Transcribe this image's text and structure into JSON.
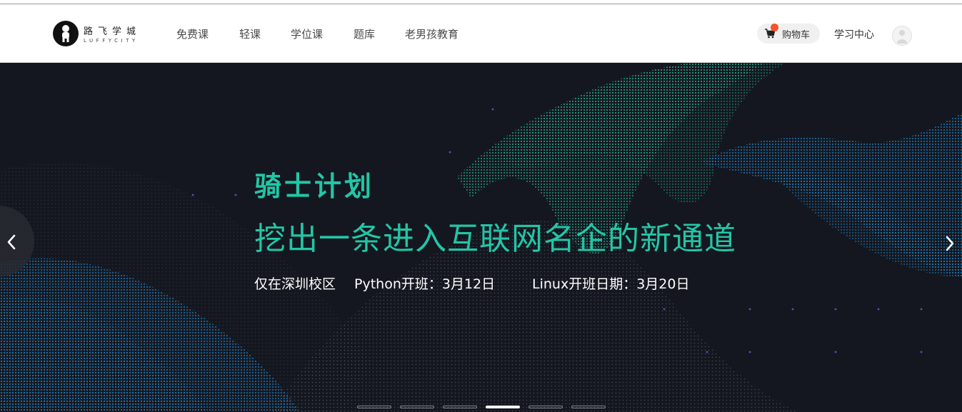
{
  "logo": {
    "name": "路飞学城",
    "sub": "LUFFYCITY"
  },
  "nav": [
    {
      "label": "免费课"
    },
    {
      "label": "轻课"
    },
    {
      "label": "学位课"
    },
    {
      "label": "题库"
    },
    {
      "label": "老男孩教育"
    }
  ],
  "header_right": {
    "cart_label": "购物车",
    "study_center": "学习中心",
    "cart_icon": "cart-icon",
    "avatar_icon": "user-avatar"
  },
  "banner": {
    "title": "骑士计划",
    "subtitle": "挖出一条进入互联网名企的新通道",
    "info1": "仅在深圳校区",
    "info2": "Python开班：3月12日",
    "info3": "Linux开班日期：3月20日",
    "prev_icon": "chevron-left-icon",
    "next_icon": "chevron-right-icon",
    "slides_total": 6,
    "active_slide": 4
  },
  "colors": {
    "accent": "#22c6a6",
    "banner_bg": "#141720",
    "cart_badge": "#f2522d",
    "wave_blue": "#1e9be6"
  }
}
